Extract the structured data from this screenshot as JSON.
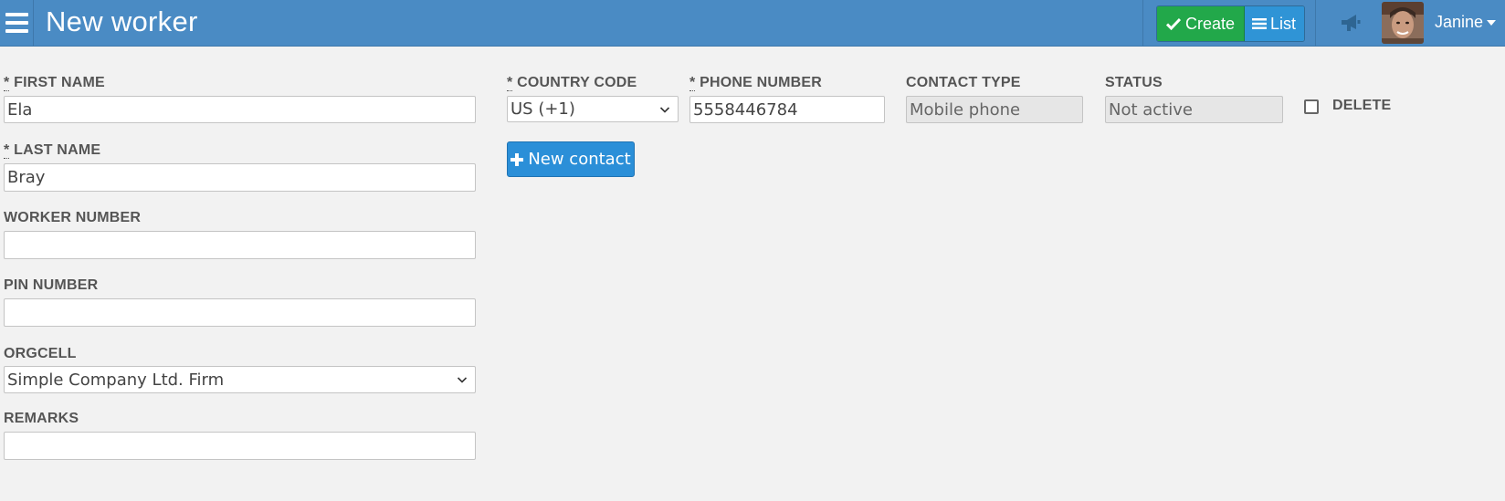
{
  "header": {
    "title": "New worker",
    "create_label": "Create",
    "list_label": "List",
    "user_name": "Janine"
  },
  "form": {
    "first_name": {
      "label": "FIRST NAME",
      "required_mark": "*",
      "value": "Ela"
    },
    "last_name": {
      "label": "LAST NAME",
      "required_mark": "*",
      "value": "Bray"
    },
    "worker_number": {
      "label": "WORKER NUMBER",
      "value": ""
    },
    "pin_number": {
      "label": "PIN NUMBER",
      "value": ""
    },
    "orgcell": {
      "label": "ORGCELL",
      "value": "Simple Company Ltd. Firm"
    },
    "remarks": {
      "label": "REMARKS",
      "value": ""
    }
  },
  "contact": {
    "country_code": {
      "label": "COUNTRY CODE",
      "required_mark": "*",
      "value": "US (+1)"
    },
    "phone_number": {
      "label": "PHONE NUMBER",
      "required_mark": "*",
      "value": "5558446784"
    },
    "contact_type": {
      "label": "CONTACT TYPE",
      "value": "Mobile phone"
    },
    "status": {
      "label": "STATUS",
      "value": "Not active"
    },
    "delete": {
      "label": "DELETE",
      "checked": false
    },
    "new_contact_label": "New contact"
  },
  "icons": {
    "menu": "hamburger-icon",
    "create": "check-icon",
    "list": "list-icon",
    "announcements": "megaphone-icon",
    "new_contact": "plus-icon",
    "dropdown": "chevron-down-icon"
  },
  "colors": {
    "topbar": "#4a8bc4",
    "create_button": "#22a84a",
    "list_button": "#2f94d6",
    "new_contact_button": "#2b8fd8",
    "background": "#f2f2f2"
  }
}
